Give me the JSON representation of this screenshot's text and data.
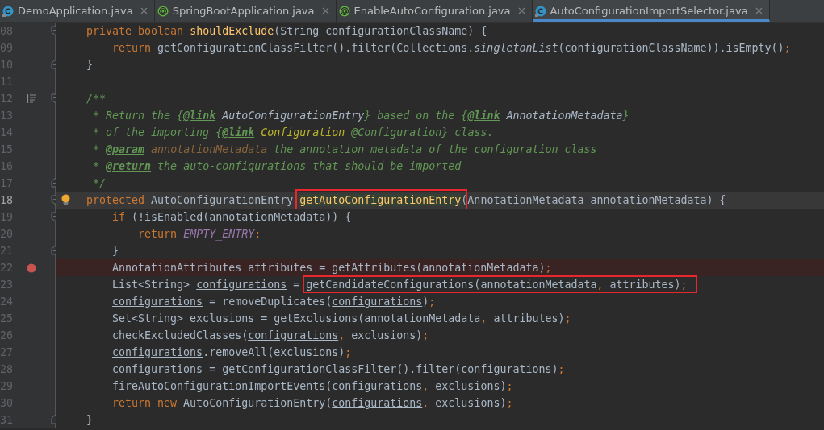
{
  "tabs": [
    {
      "label": "DemoApplication.java",
      "kind": "class",
      "selected": false
    },
    {
      "label": "SpringBootApplication.java",
      "kind": "annotation",
      "selected": false
    },
    {
      "label": "EnableAutoConfiguration.java",
      "kind": "annotation",
      "selected": false
    },
    {
      "label": "AutoConfigurationImportSelector.java",
      "kind": "class",
      "selected": true
    }
  ],
  "lines": [
    {
      "number": "08",
      "gutter": [
        {
          "kind": "fold-start"
        }
      ],
      "current": false,
      "tokens": [
        {
          "kind": "keyword",
          "text": "    private boolean "
        },
        {
          "kind": "method",
          "text": "shouldExclude"
        },
        {
          "kind": "plain",
          "text": "(String configurationClassName) {"
        }
      ]
    },
    {
      "number": "09",
      "current": false,
      "tokens": [
        {
          "kind": "keyword",
          "text": "        return "
        },
        {
          "kind": "plain",
          "text": "getConfigurationClassFilter().filter(Collections."
        },
        {
          "kind": "static-call",
          "text": "singletonList"
        },
        {
          "kind": "plain",
          "text": "(configurationClassName)).isEmpty()"
        },
        {
          "kind": "punct",
          "text": ";"
        }
      ]
    },
    {
      "number": "10",
      "gutter": [
        {
          "kind": "fold-end"
        }
      ],
      "current": false,
      "tokens": [
        {
          "kind": "plain",
          "text": "    }"
        }
      ]
    },
    {
      "number": "11",
      "current": false
    },
    {
      "number": "12",
      "gutter": [
        {
          "kind": "doc"
        },
        {
          "kind": "fold-start"
        }
      ],
      "current": false,
      "tokens": [
        {
          "kind": "comment",
          "text": "    /**"
        }
      ]
    },
    {
      "number": "13",
      "current": false,
      "tokens": [
        {
          "kind": "comment",
          "text": "     * Return the {"
        },
        {
          "kind": "doc-tag",
          "text": "@link"
        },
        {
          "kind": "doc-ref",
          "text": " AutoConfigurationEntry"
        },
        {
          "kind": "comment",
          "text": "} based on the {"
        },
        {
          "kind": "doc-tag",
          "text": "@link"
        },
        {
          "kind": "doc-ref",
          "text": " AnnotationMetadata"
        },
        {
          "kind": "comment",
          "text": "}"
        }
      ]
    },
    {
      "number": "14",
      "current": false,
      "tokens": [
        {
          "kind": "comment",
          "text": "     * of the importing {"
        },
        {
          "kind": "doc-tag",
          "text": "@link"
        },
        {
          "kind": "doc-annotation",
          "text": " Configuration"
        },
        {
          "kind": "comment",
          "text": " @Configuration} class."
        }
      ]
    },
    {
      "number": "15",
      "current": false,
      "tokens": [
        {
          "kind": "comment",
          "text": "     * "
        },
        {
          "kind": "doc-tag",
          "text": "@param"
        },
        {
          "kind": "doc-param",
          "text": " annotationMetadata"
        },
        {
          "kind": "comment",
          "text": " the annotation metadata of the configuration class"
        }
      ]
    },
    {
      "number": "16",
      "current": false,
      "tokens": [
        {
          "kind": "comment",
          "text": "     * "
        },
        {
          "kind": "doc-tag",
          "text": "@return"
        },
        {
          "kind": "comment",
          "text": " the auto-configurations that should be imported"
        }
      ]
    },
    {
      "number": "17",
      "gutter": [
        {
          "kind": "fold-end"
        }
      ],
      "current": false,
      "tokens": [
        {
          "kind": "comment",
          "text": "     */"
        }
      ]
    },
    {
      "number": "18",
      "gutter": [
        {
          "kind": "fold-start"
        },
        {
          "kind": "bulb"
        }
      ],
      "current": true,
      "tokens": [
        {
          "kind": "keyword",
          "text": "    protected "
        },
        {
          "kind": "plain",
          "text": "AutoConfigurationEntry "
        },
        {
          "kind": "boxed",
          "tokens": [
            {
              "kind": "method-highlighted",
              "text": "getAutoConfigurationEntry"
            }
          ]
        },
        {
          "kind": "plain",
          "text": "(AnnotationMetadata annotationMetadata) {"
        }
      ]
    },
    {
      "number": "19",
      "gutter": [
        {
          "kind": "fold-start"
        }
      ],
      "current": false,
      "tokens": [
        {
          "kind": "keyword",
          "text": "        if "
        },
        {
          "kind": "plain",
          "text": "(!isEnabled(annotationMetadata)) {"
        }
      ]
    },
    {
      "number": "20",
      "current": false,
      "tokens": [
        {
          "kind": "keyword",
          "text": "            return "
        },
        {
          "kind": "constant",
          "text": "EMPTY_ENTRY"
        },
        {
          "kind": "punct",
          "text": ";"
        }
      ]
    },
    {
      "number": "21",
      "gutter": [
        {
          "kind": "fold-end"
        }
      ],
      "current": false,
      "tokens": [
        {
          "kind": "plain",
          "text": "        }"
        }
      ]
    },
    {
      "number": "22",
      "gutter": [
        {
          "kind": "breakpoint"
        }
      ],
      "current": false,
      "tokens": [
        {
          "kind": "plain",
          "text": "        AnnotationAttributes attributes = getAttributes(annotationMetadata)"
        },
        {
          "kind": "punct",
          "text": ";"
        }
      ]
    },
    {
      "number": "23",
      "current": false,
      "tokens": [
        {
          "kind": "plain",
          "text": "        List<String> "
        },
        {
          "kind": "var",
          "text": "configurations"
        },
        {
          "kind": "plain",
          "text": " = "
        },
        {
          "kind": "boxed",
          "tokens": [
            {
              "kind": "plain",
              "text": "getCandidateConfigurations(annotationMetadata"
            },
            {
              "kind": "punct",
              "text": ","
            },
            {
              "kind": "plain",
              "text": " attributes)"
            },
            {
              "kind": "punct",
              "text": ";"
            }
          ]
        }
      ]
    },
    {
      "number": "24",
      "current": false,
      "tokens": [
        {
          "kind": "var",
          "text": "        configurations"
        },
        {
          "kind": "plain",
          "text": " = removeDuplicates("
        },
        {
          "kind": "var",
          "text": "configurations"
        },
        {
          "kind": "plain",
          "text": ")"
        },
        {
          "kind": "punct",
          "text": ";"
        }
      ]
    },
    {
      "number": "25",
      "current": false,
      "tokens": [
        {
          "kind": "plain",
          "text": "        Set<String> exclusions = getExclusions(annotationMetadata"
        },
        {
          "kind": "punct",
          "text": ","
        },
        {
          "kind": "plain",
          "text": " attributes)"
        },
        {
          "kind": "punct",
          "text": ";"
        }
      ]
    },
    {
      "number": "26",
      "current": false,
      "tokens": [
        {
          "kind": "plain",
          "text": "        checkExcludedClasses("
        },
        {
          "kind": "var",
          "text": "configurations"
        },
        {
          "kind": "punct",
          "text": ","
        },
        {
          "kind": "plain",
          "text": " exclusions)"
        },
        {
          "kind": "punct",
          "text": ";"
        }
      ]
    },
    {
      "number": "27",
      "current": false,
      "tokens": [
        {
          "kind": "var",
          "text": "        configurations"
        },
        {
          "kind": "plain",
          "text": ".removeAll(exclusions)"
        },
        {
          "kind": "punct",
          "text": ";"
        }
      ]
    },
    {
      "number": "28",
      "current": false,
      "tokens": [
        {
          "kind": "var",
          "text": "        configurations"
        },
        {
          "kind": "plain",
          "text": " = getConfigurationClassFilter().filter("
        },
        {
          "kind": "var",
          "text": "configurations"
        },
        {
          "kind": "plain",
          "text": ")"
        },
        {
          "kind": "punct",
          "text": ";"
        }
      ]
    },
    {
      "number": "29",
      "current": false,
      "tokens": [
        {
          "kind": "plain",
          "text": "        fireAutoConfigurationImportEvents("
        },
        {
          "kind": "var",
          "text": "configurations"
        },
        {
          "kind": "punct",
          "text": ","
        },
        {
          "kind": "plain",
          "text": " exclusions)"
        },
        {
          "kind": "punct",
          "text": ";"
        }
      ]
    },
    {
      "number": "30",
      "current": false,
      "tokens": [
        {
          "kind": "keyword",
          "text": "        return new "
        },
        {
          "kind": "plain",
          "text": "AutoConfigurationEntry("
        },
        {
          "kind": "var",
          "text": "configurations"
        },
        {
          "kind": "punct",
          "text": ","
        },
        {
          "kind": "plain",
          "text": " exclusions)"
        },
        {
          "kind": "punct",
          "text": ";"
        }
      ]
    },
    {
      "number": "31",
      "gutter": [
        {
          "kind": "fold-end"
        }
      ],
      "current": false,
      "tokens": [
        {
          "kind": "plain",
          "text": "    }"
        }
      ]
    }
  ]
}
